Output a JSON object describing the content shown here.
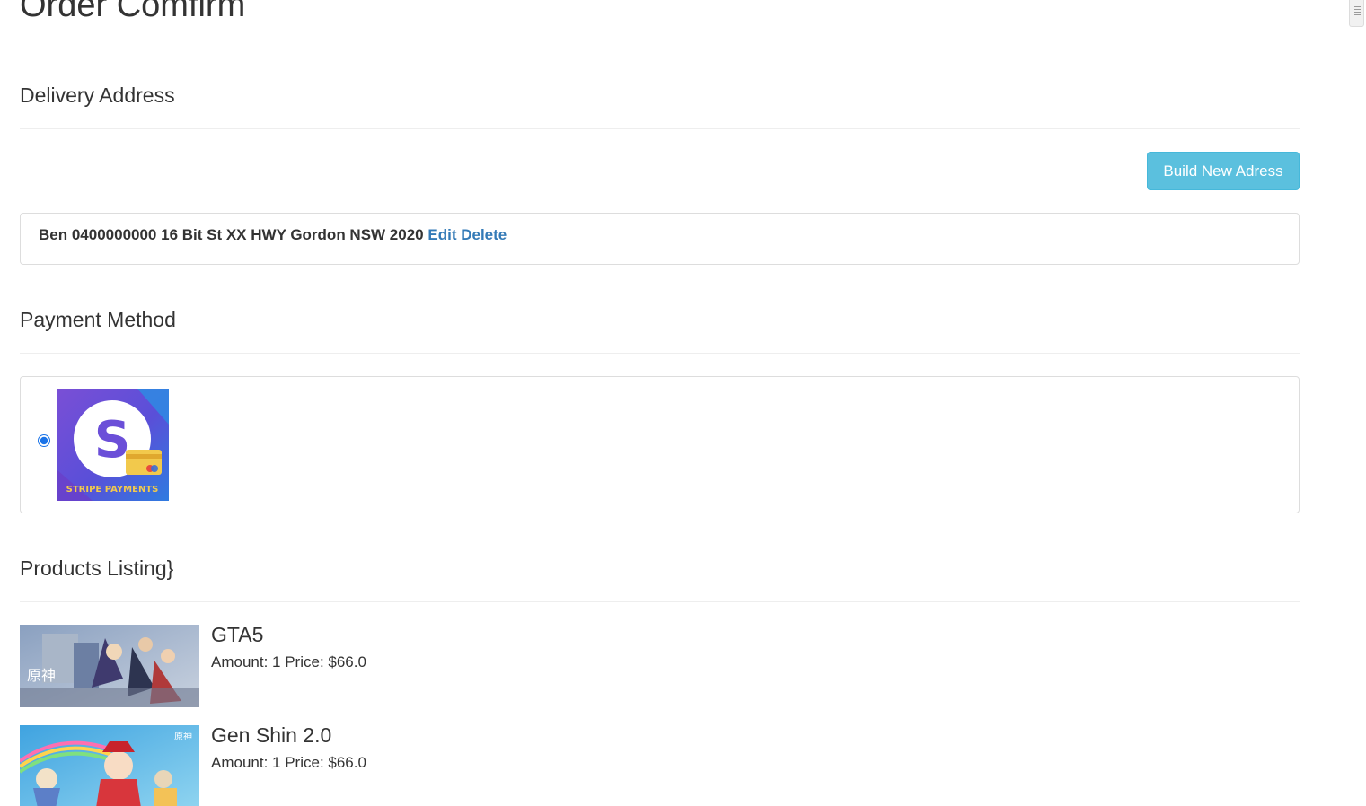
{
  "page": {
    "title": "Order Comfirm"
  },
  "delivery": {
    "heading": "Delivery Address",
    "new_address_button": "Build New Adress",
    "address": {
      "text": "Ben 0400000000 16 Bit St XX HWY Gordon NSW 2020",
      "edit_label": "Edit",
      "delete_label": "Delete"
    }
  },
  "payment": {
    "heading": "Payment Method",
    "selected": true,
    "logo_text": "STRIPE PAYMENTS",
    "logo_icon": "stripe-payments-logo"
  },
  "products": {
    "heading": "Products Listing}",
    "items": [
      {
        "name": "GTA5",
        "meta": "Amount: 1 Price: $66.0",
        "thumbnail_text": "原神"
      },
      {
        "name": "Gen Shin 2.0",
        "meta": "Amount: 1 Price: $66.0",
        "thumbnail_text": "原神"
      }
    ]
  },
  "colors": {
    "info_button": "#5bc0de",
    "link": "#337ab7",
    "border": "#dddddd",
    "divider": "#eeeeee",
    "stripe_purple": "#6b4fd8",
    "card_yellow": "#f2c94c"
  }
}
